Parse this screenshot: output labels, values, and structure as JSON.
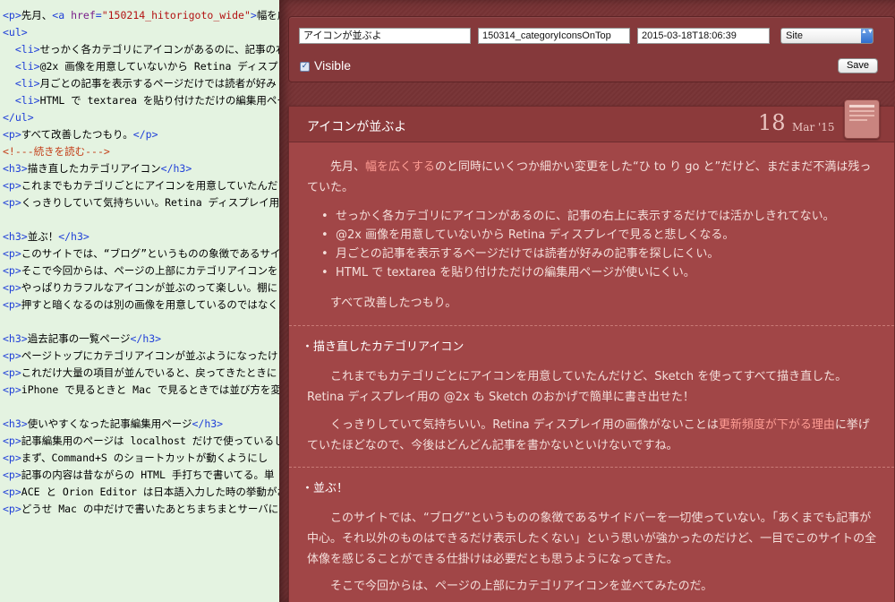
{
  "editor": {
    "lines": [
      [
        {
          "c": "tag",
          "t": "<p>"
        },
        {
          "c": "txt",
          "t": "先月、"
        },
        {
          "c": "tag",
          "t": "<a "
        },
        {
          "c": "attr",
          "t": "href"
        },
        {
          "c": "tag",
          "t": "="
        },
        {
          "c": "str",
          "t": "\"150214_hitorigoto_wide\""
        },
        {
          "c": "tag",
          "t": ">"
        },
        {
          "c": "txt",
          "t": "幅を広く"
        }
      ],
      [
        {
          "c": "tag",
          "t": "<ul>"
        }
      ],
      [
        {
          "c": "txt",
          "t": "  "
        },
        {
          "c": "tag",
          "t": "<li>"
        },
        {
          "c": "txt",
          "t": "せっかく各カテゴリにアイコンがあるのに、記事の右"
        }
      ],
      [
        {
          "c": "txt",
          "t": "  "
        },
        {
          "c": "tag",
          "t": "<li>"
        },
        {
          "c": "txt",
          "t": "@2x 画像を用意していないから Retina ディスプレ"
        }
      ],
      [
        {
          "c": "txt",
          "t": "  "
        },
        {
          "c": "tag",
          "t": "<li>"
        },
        {
          "c": "txt",
          "t": "月ごとの記事を表示するページだけでは読者が好み"
        }
      ],
      [
        {
          "c": "txt",
          "t": "  "
        },
        {
          "c": "tag",
          "t": "<li>"
        },
        {
          "c": "txt",
          "t": "HTML で textarea を貼り付けただけの編集用ページ"
        }
      ],
      [
        {
          "c": "tag",
          "t": "</ul>"
        }
      ],
      [
        {
          "c": "tag",
          "t": "<p>"
        },
        {
          "c": "txt",
          "t": "すべて改善したつもり。"
        },
        {
          "c": "tag",
          "t": "</p>"
        }
      ],
      [
        {
          "c": "cmt",
          "t": "<!---続きを読む--->"
        }
      ],
      [
        {
          "c": "tag",
          "t": "<h3>"
        },
        {
          "c": "txt",
          "t": "描き直したカテゴリアイコン"
        },
        {
          "c": "tag",
          "t": "</h3>"
        }
      ],
      [
        {
          "c": "tag",
          "t": "<p>"
        },
        {
          "c": "txt",
          "t": "これまでもカテゴリごとにアイコンを用意していたんだ"
        }
      ],
      [
        {
          "c": "tag",
          "t": "<p>"
        },
        {
          "c": "txt",
          "t": "くっきりしていて気持ちいい。Retina ディスプレイ用の"
        }
      ],
      [
        {
          "c": "txt",
          "t": ""
        }
      ],
      [
        {
          "c": "tag",
          "t": "<h3>"
        },
        {
          "c": "txt",
          "t": "並ぶ！"
        },
        {
          "c": "tag",
          "t": "</h3>"
        }
      ],
      [
        {
          "c": "tag",
          "t": "<p>"
        },
        {
          "c": "txt",
          "t": "このサイトでは、“ブログ”というものの象徴であるサイ"
        }
      ],
      [
        {
          "c": "tag",
          "t": "<p>"
        },
        {
          "c": "txt",
          "t": "そこで今回からは、ページの上部にカテゴリアイコンを"
        }
      ],
      [
        {
          "c": "tag",
          "t": "<p>"
        },
        {
          "c": "txt",
          "t": "やっぱりカラフルなアイコンが並ぶのって楽しい。棚に"
        }
      ],
      [
        {
          "c": "tag",
          "t": "<p>"
        },
        {
          "c": "txt",
          "t": "押すと暗くなるのは別の画像を用意しているのではなく"
        }
      ],
      [
        {
          "c": "txt",
          "t": ""
        }
      ],
      [
        {
          "c": "tag",
          "t": "<h3>"
        },
        {
          "c": "txt",
          "t": "過去記事の一覧ページ"
        },
        {
          "c": "tag",
          "t": "</h3>"
        }
      ],
      [
        {
          "c": "tag",
          "t": "<p>"
        },
        {
          "c": "txt",
          "t": "ページトップにカテゴリアイコンが並ぶようになったけ"
        }
      ],
      [
        {
          "c": "tag",
          "t": "<p>"
        },
        {
          "c": "txt",
          "t": "これだけ大量の項目が並んでいると、戻ってきたときに"
        }
      ],
      [
        {
          "c": "tag",
          "t": "<p>"
        },
        {
          "c": "txt",
          "t": "iPhone で見るときと Mac で見るときでは並び方を変え"
        }
      ],
      [
        {
          "c": "txt",
          "t": ""
        }
      ],
      [
        {
          "c": "tag",
          "t": "<h3>"
        },
        {
          "c": "txt",
          "t": "使いやすくなった記事編集用ページ"
        },
        {
          "c": "tag",
          "t": "</h3>"
        }
      ],
      [
        {
          "c": "tag",
          "t": "<p>"
        },
        {
          "c": "txt",
          "t": "記事編集用のページは localhost だけで使っているし、"
        }
      ],
      [
        {
          "c": "tag",
          "t": "<p>"
        },
        {
          "c": "txt",
          "t": "まず、Command+S のショートカットが動くようにし"
        }
      ],
      [
        {
          "c": "tag",
          "t": "<p>"
        },
        {
          "c": "txt",
          "t": "記事の内容は昔ながらの HTML 手打ちで書いてる。単"
        }
      ],
      [
        {
          "c": "tag",
          "t": "<p>"
        },
        {
          "c": "txt",
          "t": "ACE と Orion Editor は日本語入力した時の挙動がおか"
        }
      ],
      [
        {
          "c": "tag",
          "t": "<p>"
        },
        {
          "c": "txt",
          "t": "どうせ Mac の中だけで書いたあとちまちまとサーバに"
        }
      ]
    ]
  },
  "form": {
    "title_value": "アイコンが並ぶよ",
    "slug_value": "150314_categoryIconsOnTop",
    "date_value": "2015-03-18T18:06:39",
    "site_value": "Site",
    "visible_label": "Visible",
    "visible_checked": "✓",
    "save_label": "Save",
    "select_arrow": "▲▼"
  },
  "article": {
    "title": "アイコンが並ぶよ",
    "day": "18",
    "month": "Mar '15",
    "intro_before": "先月、",
    "intro_link": "幅を広くする",
    "intro_after": "のと同時にいくつか細かい変更をした“ひ to り go と”だけど、まだまだ不満は残っていた。",
    "bullets": [
      "せっかく各カテゴリにアイコンがあるのに、記事の右上に表示するだけでは活かしきれてない。",
      "@2x 画像を用意していないから Retina ディスプレイで見ると悲しくなる。",
      "月ごとの記事を表示するページだけでは読者が好みの記事を探しにくい。",
      "HTML で textarea を貼り付けただけの編集用ページが使いにくい。"
    ],
    "summary": "すべて改善したつもり。",
    "section1_heading": "・描き直したカテゴリアイコン",
    "section1_p1": "これまでもカテゴリごとにアイコンを用意していたんだけど、Sketch を使ってすべて描き直した。Retina ディスプレイ用の @2x も Sketch のおかげで簡単に書き出せた！",
    "section1_p2_before": "くっきりしていて気持ちいい。Retina ディスプレイ用の画像がないことは",
    "section1_p2_link": "更新頻度が下がる理由",
    "section1_p2_after": "に挙げていたほどなので、今後はどんどん記事を書かないといけないですね。",
    "section2_heading": "・並ぶ！",
    "section2_p1": "このサイトでは、“ブログ”というものの象徴であるサイドバーを一切使っていない。「あくまでも記事が中心。それ以外のものはできるだけ表示したくない」という思いが強かったのだけど、一目でこのサイトの全体像を感じることができる仕掛けは必要だとも思うようになってきた。",
    "section2_p2": "そこで今回からは、ページの上部にカテゴリアイコンを並べてみたのだ。"
  }
}
